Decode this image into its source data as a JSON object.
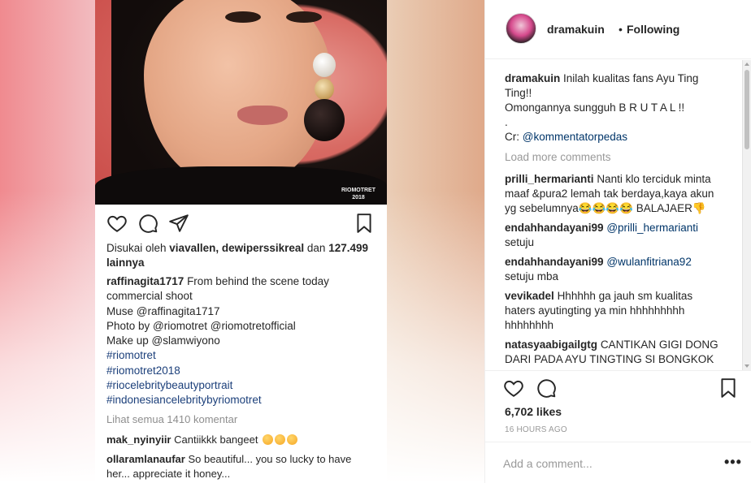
{
  "post_image": {
    "watermark_line1": "RIOMOTRET",
    "watermark_line2": "2018",
    "likes_prefix": "Disukai oleh ",
    "likes_users": "viavallen, dewiperssikreal",
    "likes_joiner": " dan ",
    "likes_count": "127.499",
    "likes_suffix": " lainnya",
    "caption_user": "raffinagita1717",
    "caption_lines": [
      "From behind the scene today",
      "commercial shoot",
      "Muse @raffinagita1717",
      "Photo by @riomotret @riomotretofficial",
      "Make up @slamwiyono"
    ],
    "caption_tags": [
      "#riomotret",
      "#riomotret2018",
      "#riocelebritybeautyportrait",
      "#indonesiancelebritybyriomotret"
    ],
    "view_all": "Lihat semua 1410 komentar",
    "comments": [
      {
        "user": "mak_nyinyiir",
        "text": "Cantiikkk bangeet"
      },
      {
        "user": "ollaramlanaufar",
        "text": "So beautiful... you so lucky to have",
        "text2": "her... appreciate it honey..."
      }
    ]
  },
  "panel": {
    "username": "dramakuin",
    "separator": "•",
    "follow_state": "Following",
    "caption": {
      "user": "dramakuin",
      "line1": "Inilah kualitas fans Ayu Ting",
      "line2": "Ting!!",
      "line3": "Omongannya sungguh B R U T A L !!",
      "line4": ".",
      "credit_prefix": "Cr: ",
      "credit_tag": "@kommentatorpedas"
    },
    "load_more": "Load more comments",
    "comments": [
      {
        "user": "prilli_hermarianti",
        "line1": "Nanti klo terciduk minta",
        "line2": "maaf &pura2 lemah tak berdaya,kaya akun",
        "line3": "yg sebelumnya😂😂😂😂 BALAJAER👎"
      },
      {
        "user": "endahhandayani99",
        "tag": "@prilli_hermarianti",
        "line2": "setuju"
      },
      {
        "user": "endahhandayani99",
        "tag": "@wulanfitriana92",
        "line2": "setuju mba"
      },
      {
        "user": "vevikadel",
        "line1": "Hhhhhh ga jauh sm kualitas",
        "line2": "haters ayutingting ya min hhhhhhhhh",
        "line3": "hhhhhhhh"
      },
      {
        "user": "natasyaabigailgtg",
        "line1": "CANTIKAN GIGI DONG",
        "line2": "DARI PADA AYU TINGTING SI BONGKOK"
      }
    ],
    "likes": "6,702 likes",
    "time": "16 HOURS AGO",
    "add_comment_placeholder": "Add a comment...",
    "more_label": "•••"
  },
  "icons": {
    "heart": "heart-icon",
    "comment": "comment-icon",
    "share": "share-icon",
    "bookmark": "bookmark-icon"
  },
  "colors": {
    "link": "#003569",
    "muted": "#999999",
    "text": "#262626"
  }
}
